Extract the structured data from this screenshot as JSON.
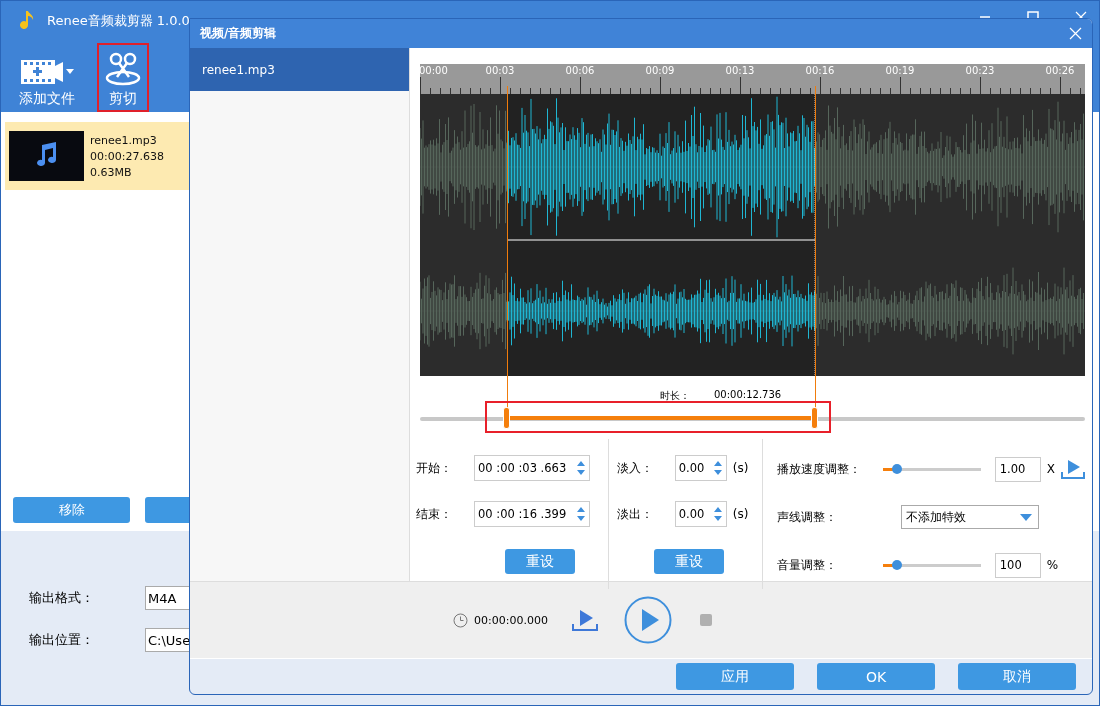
{
  "main_window": {
    "title": "Renee音频裁剪器 1.0.0",
    "toolbar": [
      {
        "kind": "add",
        "label": "添加文件",
        "highlighted": false
      },
      {
        "kind": "cut",
        "label": "剪切",
        "highlighted": true
      }
    ],
    "files": [
      {
        "name": "renee1.mp3",
        "duration": "00:00:27.638",
        "size": "0.63MB",
        "selected": true
      }
    ],
    "buttons": [
      "移除"
    ],
    "output": [
      {
        "label": "输出格式：",
        "value": "M4A"
      },
      {
        "label": "输出位置：",
        "value": "C:\\Use"
      }
    ]
  },
  "dialog": {
    "title": "视频/音频剪辑",
    "files": [
      {
        "name": "renee1.mp3",
        "selected": true
      }
    ],
    "ruler_labels": [
      "00:00",
      "00:03",
      "00:06",
      "00:09",
      "00:13",
      "00:16",
      "00:19",
      "00:23",
      "00:26"
    ],
    "duration_label": "时长：",
    "duration": "00:00:12.736",
    "trim": {
      "handles": [
        {
          "level": 0.131
        },
        {
          "level": 0.594
        }
      ],
      "highlighted": true
    },
    "time_fields": [
      {
        "label": "开始：",
        "value": "00 :00 :03 .663"
      },
      {
        "label": "结束：",
        "value": "00 :00 :16 .399"
      }
    ],
    "fade_fields": [
      {
        "label": "淡入：",
        "value": "0.00",
        "unit": "(s)"
      },
      {
        "label": "淡出：",
        "value": "0.00",
        "unit": "(s)"
      }
    ],
    "reset_buttons": [
      "重设",
      "重设"
    ],
    "adjustments": [
      {
        "kind": "slider_preview",
        "label": "播放速度调整：",
        "level": 0.15,
        "value": "1.00",
        "unit": "X"
      },
      {
        "kind": "dropdown",
        "label": "声线调整：",
        "value": "不添加特效"
      },
      {
        "kind": "slider",
        "label": "音量调整：",
        "level": 0.15,
        "value": "100",
        "unit": "%"
      }
    ],
    "playback_time": "00:00:00.000",
    "buttons": [
      "应用",
      "OK",
      "取消"
    ]
  }
}
